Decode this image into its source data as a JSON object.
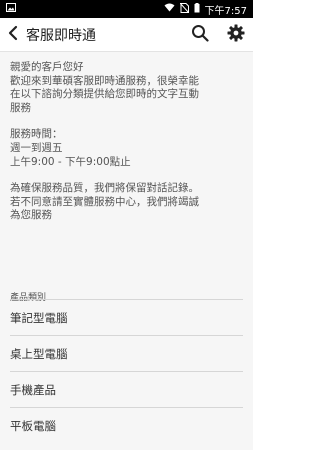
{
  "status_bar": {
    "time": "下午7:57",
    "icons": [
      "picture-icon",
      "wifi-icon",
      "no-sim-icon",
      "battery-icon"
    ]
  },
  "app_bar": {
    "title": "客服即時通",
    "icons": [
      "back-arrow-icon",
      "search-icon",
      "gear-icon"
    ]
  },
  "intro": {
    "greeting": "親愛的客戶您好",
    "welcome_lines": [
      "歡迎來到華碩客服即時通服務，很榮幸能",
      "在以下諮詢分類提供給您即時的文字互動",
      "服務"
    ],
    "hours_title": "服務時間：",
    "hours_days": "週一到週五",
    "hours_time": "上午9:00 - 下午9:00點止",
    "notice_lines": [
      "為確保服務品質，我們將保留對話記錄。",
      "若不同意請至實體服務中心，我們將竭誠",
      "為您服務"
    ]
  },
  "categories": {
    "header": "產品類別",
    "items": [
      {
        "label": "筆記型電腦"
      },
      {
        "label": "桌上型電腦"
      },
      {
        "label": "手機產品"
      },
      {
        "label": "平板電腦"
      }
    ]
  }
}
